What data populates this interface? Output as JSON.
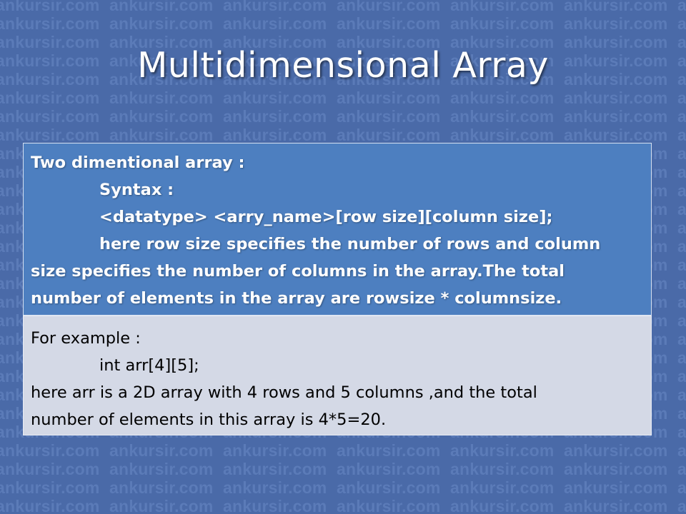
{
  "watermark_text": "ankursir.com",
  "title": "Multidimensional Array",
  "definition_box": {
    "heading": "Two dimentional array :",
    "syntax_label": "Syntax :",
    "syntax_code": "<datatype> <arry_name>[row size][column size];",
    "description_line1": "here row size specifies the number of rows and column",
    "description_line2": "size specifies the number of columns in the array.The total",
    "description_line3": "number of elements in the array are rowsize * columnsize."
  },
  "example_box": {
    "heading": "For example :",
    "code": "int arr[4][5];",
    "explanation_line1": "here arr is a 2D array with 4 rows and 5 columns ,and the total",
    "explanation_line2": "number of elements in this array is 4*5=20."
  }
}
